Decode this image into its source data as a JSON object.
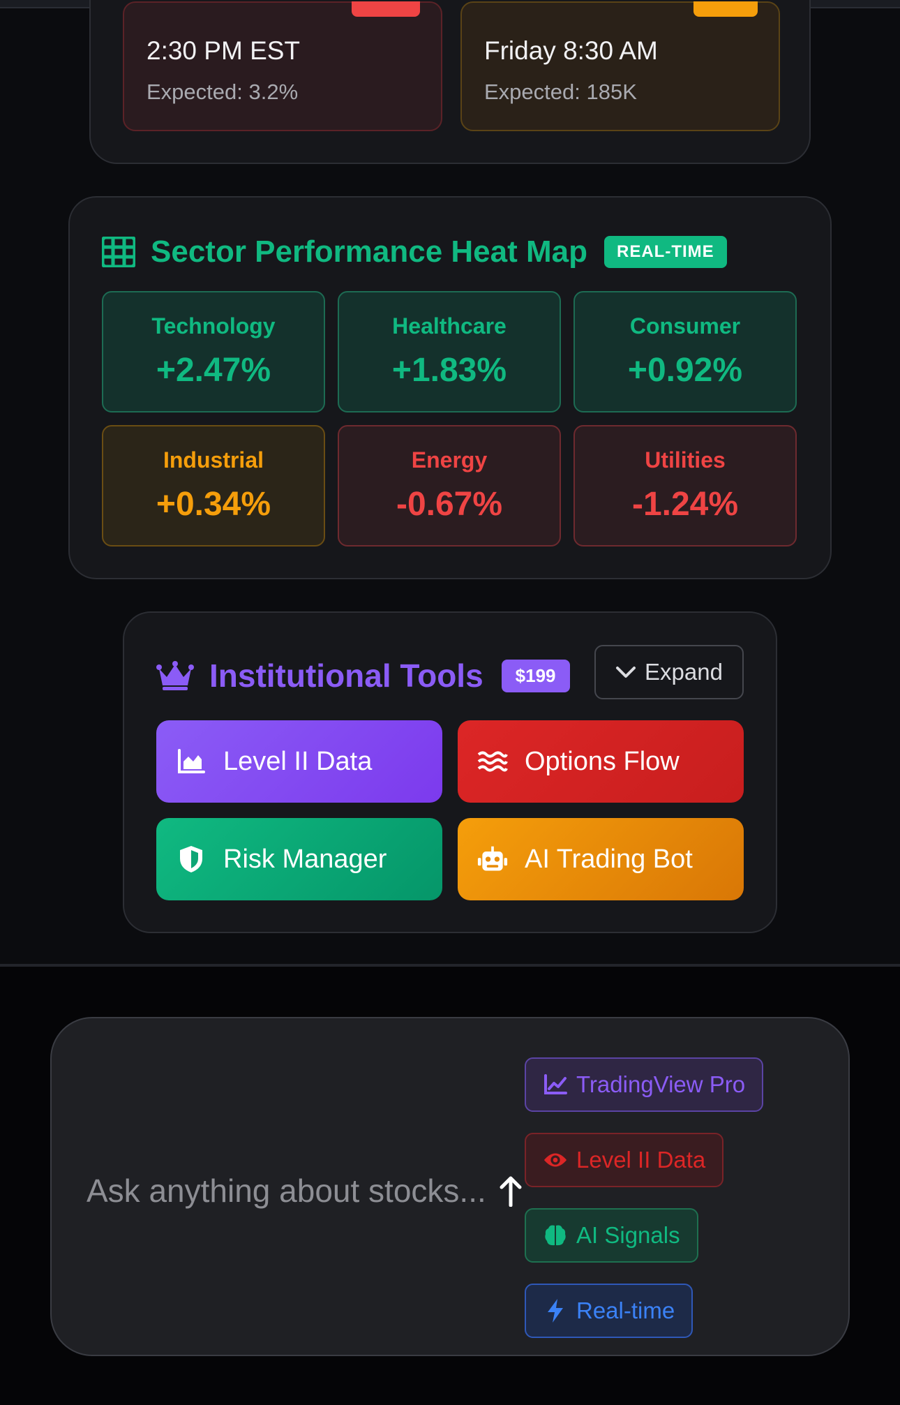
{
  "events": [
    {
      "time": "2:30 PM EST",
      "expected": "Expected: 3.2%",
      "tone": "red"
    },
    {
      "time": "Friday 8:30 AM",
      "expected": "Expected: 185K",
      "tone": "amber"
    }
  ],
  "heatmap": {
    "icon": "grid-icon",
    "title": "Sector Performance Heat Map",
    "badge": "REAL-TIME",
    "sectors": [
      {
        "name": "Technology",
        "value": "+2.47%",
        "tone": "green"
      },
      {
        "name": "Healthcare",
        "value": "+1.83%",
        "tone": "green"
      },
      {
        "name": "Consumer",
        "value": "+0.92%",
        "tone": "green"
      },
      {
        "name": "Industrial",
        "value": "+0.34%",
        "tone": "amber"
      },
      {
        "name": "Energy",
        "value": "-0.67%",
        "tone": "red"
      },
      {
        "name": "Utilities",
        "value": "-1.24%",
        "tone": "red"
      }
    ]
  },
  "institutional": {
    "icon": "crown-icon",
    "title": "Institutional Tools",
    "price": "$199",
    "expand_label": "Expand",
    "tools": [
      {
        "label": "Level II Data",
        "icon": "area-chart-icon",
        "color": "#8b5cf6"
      },
      {
        "label": "Options Flow",
        "icon": "water-icon",
        "color": "#dc2626"
      },
      {
        "label": "Risk Manager",
        "icon": "shield-icon",
        "color": "#10b981"
      },
      {
        "label": "AI Trading Bot",
        "icon": "robot-icon",
        "color": "#f59e0b"
      }
    ]
  },
  "chat": {
    "placeholder": "Ask anything about stocks...",
    "chips": [
      {
        "label": "TradingView Pro",
        "icon": "line-chart-icon",
        "color": "#8b5cf6"
      },
      {
        "label": "Level II Data",
        "icon": "eye-icon",
        "color": "#dc2626"
      },
      {
        "label": "AI Signals",
        "icon": "brain-icon",
        "color": "#10b981"
      },
      {
        "label": "Real-time",
        "icon": "bolt-icon",
        "color": "#3b82f6"
      }
    ]
  }
}
